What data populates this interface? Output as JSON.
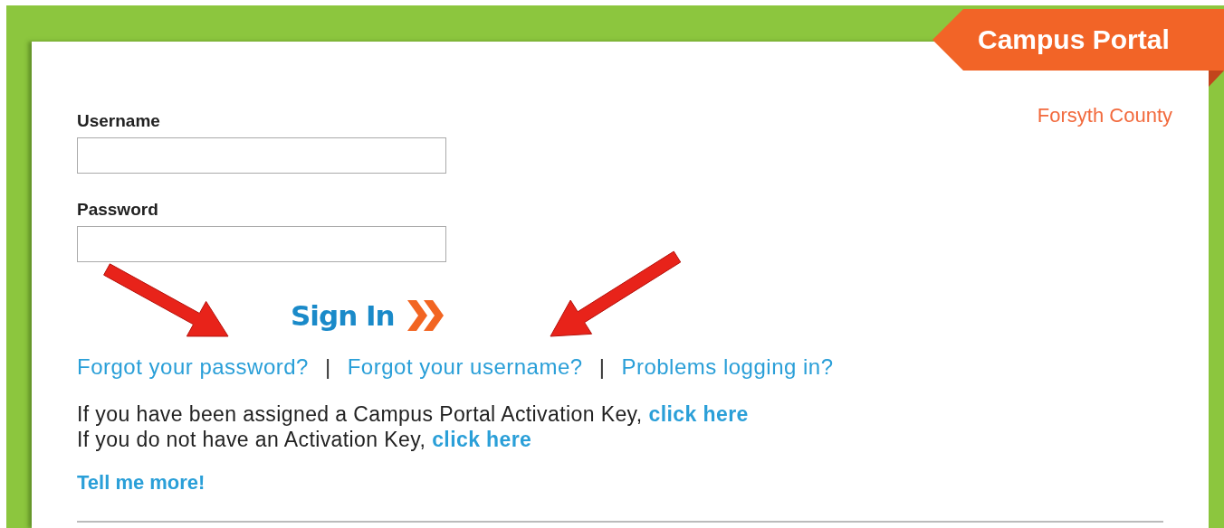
{
  "header": {
    "badge": "Campus Portal",
    "district": "Forsyth County"
  },
  "fields": [
    {
      "label": "Username"
    },
    {
      "label": "Password"
    }
  ],
  "sign_in": "Sign In",
  "help_links": [
    "Forgot your password?",
    "Forgot your username?",
    "Problems logging in?"
  ],
  "separators": [
    "|",
    "|"
  ],
  "activation_lines": [
    {
      "text": "If you have been assigned a Campus Portal Activation Key,",
      "link": "click here"
    },
    {
      "text": "If you do not have an Activation Key,",
      "link": "click here"
    }
  ],
  "more_link": "Tell me more!"
}
